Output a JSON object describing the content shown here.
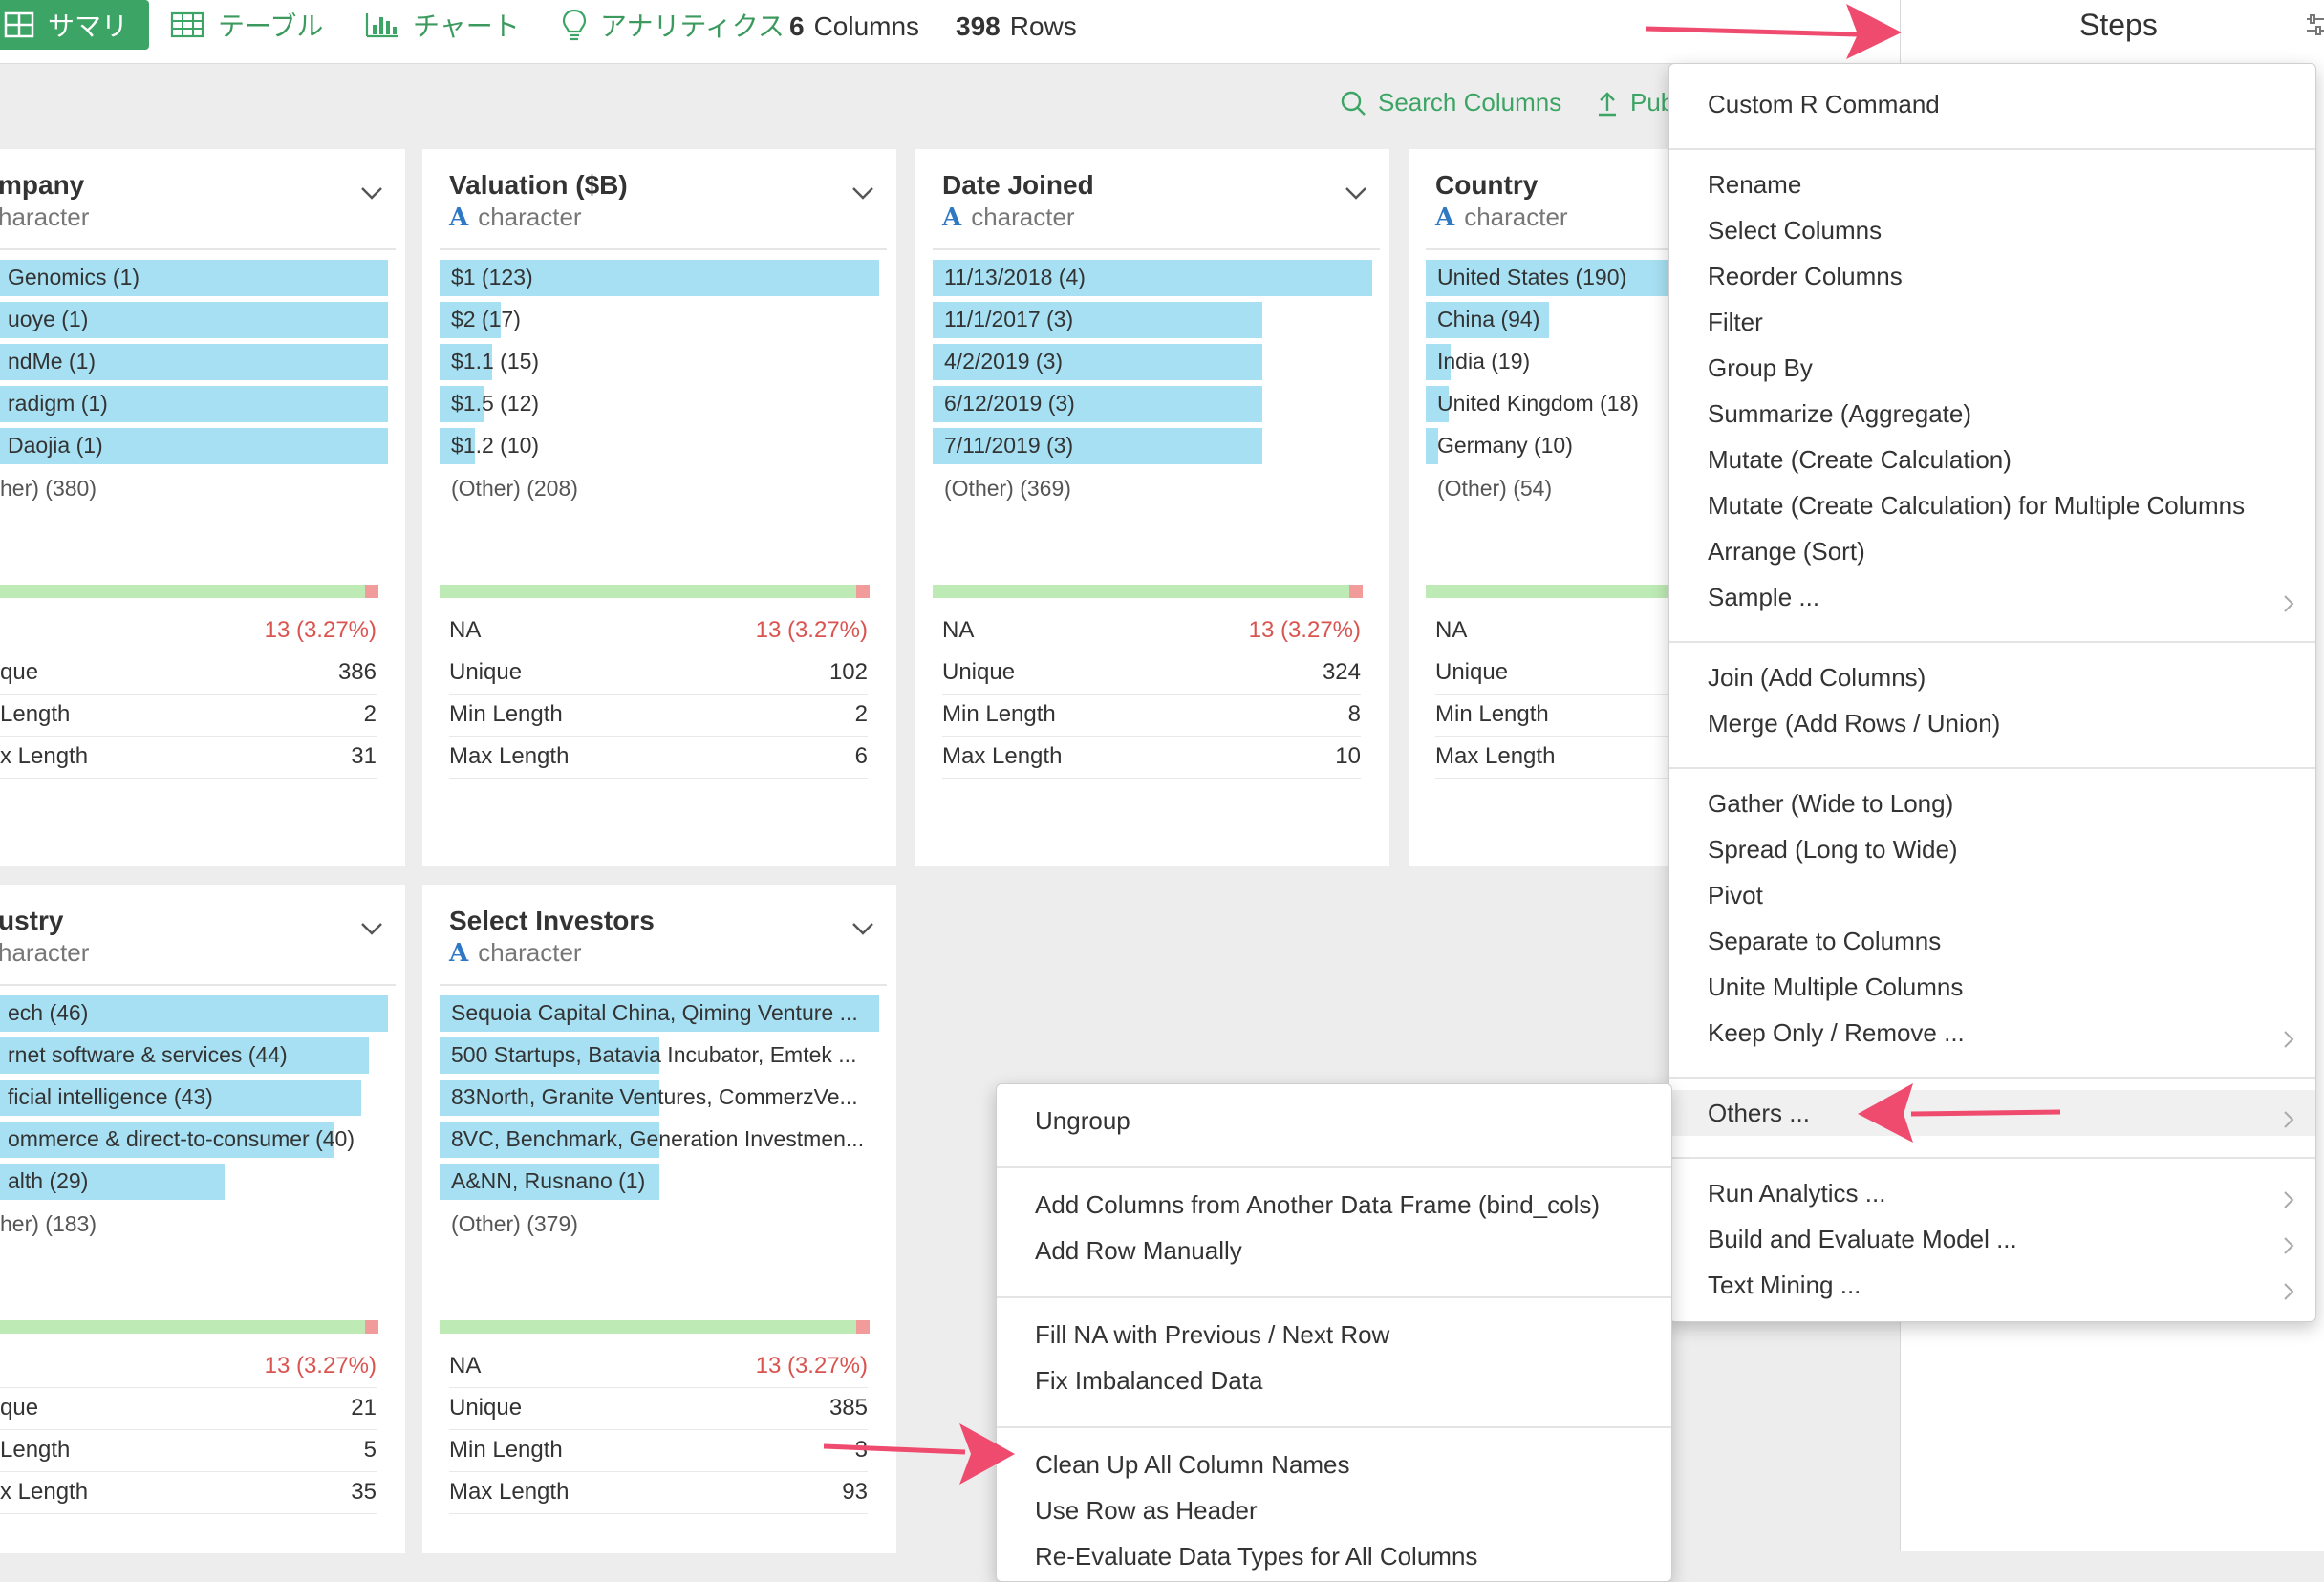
{
  "header": {
    "tabs": [
      {
        "label": "サマリ",
        "icon": "summary-grid-icon"
      },
      {
        "label": "テーブル",
        "icon": "table-icon"
      },
      {
        "label": "チャート",
        "icon": "bar-chart-icon"
      },
      {
        "label": "アナリティクス",
        "icon": "lightbulb-icon"
      }
    ],
    "columns_count": "6",
    "columns_label": "Columns",
    "rows_count": "398",
    "rows_label": "Rows",
    "steps_label": "Steps"
  },
  "toolbar": {
    "search_columns": "Search Columns",
    "publish": "Pub"
  },
  "colors": {
    "accent": "#3ca465",
    "bar": "#a6e0f2",
    "na_ok": "#bdeab5",
    "na_missing": "#f29b9b",
    "arrow": "#ef4b6e"
  },
  "cards": [
    {
      "title": "mpany",
      "type": "haracter",
      "bars": [
        {
          "label": "Genomics (1)",
          "pct": 100
        },
        {
          "label": "uoye (1)",
          "pct": 100
        },
        {
          "label": "ndMe (1)",
          "pct": 100
        },
        {
          "label": "radigm (1)",
          "pct": 100
        },
        {
          "label": "Daojia (1)",
          "pct": 100
        }
      ],
      "other": "her) (380)",
      "stats": [
        {
          "k": "",
          "v": "13 (3.27%)",
          "red": true
        },
        {
          "k": "que",
          "v": "386"
        },
        {
          "k": " Length",
          "v": "2"
        },
        {
          "k": "x Length",
          "v": "31"
        }
      ]
    },
    {
      "title": "Valuation ($B)",
      "type": "character",
      "typeIcon": "A",
      "bars": [
        {
          "label": "$1 (123)",
          "pct": 100
        },
        {
          "label": "$2 (17)",
          "pct": 14
        },
        {
          "label": "$1.1 (15)",
          "pct": 12
        },
        {
          "label": "$1.5 (12)",
          "pct": 10
        },
        {
          "label": "$1.2 (10)",
          "pct": 8
        }
      ],
      "other": "(Other) (208)",
      "stats": [
        {
          "k": "NA",
          "v": "13 (3.27%)",
          "red": true
        },
        {
          "k": "Unique",
          "v": "102"
        },
        {
          "k": "Min Length",
          "v": "2"
        },
        {
          "k": "Max Length",
          "v": "6"
        }
      ]
    },
    {
      "title": "Date Joined",
      "type": "character",
      "typeIcon": "A",
      "bars": [
        {
          "label": "11/13/2018 (4)",
          "pct": 100
        },
        {
          "label": "11/1/2017 (3)",
          "pct": 75
        },
        {
          "label": "4/2/2019 (3)",
          "pct": 75
        },
        {
          "label": "6/12/2019 (3)",
          "pct": 75
        },
        {
          "label": "7/11/2019 (3)",
          "pct": 75
        }
      ],
      "other": "(Other) (369)",
      "stats": [
        {
          "k": "NA",
          "v": "13 (3.27%)",
          "red": true
        },
        {
          "k": "Unique",
          "v": "324"
        },
        {
          "k": "Min Length",
          "v": "8"
        },
        {
          "k": "Max Length",
          "v": "10"
        }
      ]
    },
    {
      "title": "Country",
      "type": "character",
      "typeIcon": "A",
      "bars": [
        {
          "label": "United States (190)",
          "pct": 100
        },
        {
          "label": "China (94)",
          "pct": 49
        },
        {
          "label": "India (19)",
          "pct": 10
        },
        {
          "label": "United Kingdom (18)",
          "pct": 9
        },
        {
          "label": "Germany (10)",
          "pct": 5
        }
      ],
      "other": "(Other) (54)",
      "stats": [
        {
          "k": "NA",
          "v": "",
          "red": true
        },
        {
          "k": "Unique",
          "v": ""
        },
        {
          "k": "Min Length",
          "v": ""
        },
        {
          "k": "Max Length",
          "v": ""
        }
      ]
    },
    {
      "title": "ustry",
      "type": "haracter",
      "bars": [
        {
          "label": "ech (46)",
          "pct": 100
        },
        {
          "label": "rnet software & services (44)",
          "pct": 95
        },
        {
          "label": "ficial intelligence (43)",
          "pct": 93
        },
        {
          "label": "ommerce & direct-to-consumer (40)",
          "pct": 86
        },
        {
          "label": "alth (29)",
          "pct": 58
        }
      ],
      "other": "her) (183)",
      "stats": [
        {
          "k": "",
          "v": "13 (3.27%)",
          "red": true
        },
        {
          "k": "que",
          "v": "21"
        },
        {
          "k": " Length",
          "v": "5"
        },
        {
          "k": "x Length",
          "v": "35"
        }
      ]
    },
    {
      "title": "Select Investors",
      "type": "character",
      "typeIcon": "A",
      "bars": [
        {
          "label": "Sequoia Capital China, Qiming Venture ...",
          "pct": 100
        },
        {
          "label": "500 Startups, Batavia Incubator, Emtek ...",
          "pct": 50
        },
        {
          "label": "83North, Granite Ventures, CommerzVe...",
          "pct": 50
        },
        {
          "label": "8VC, Benchmark, Generation Investmen...",
          "pct": 50
        },
        {
          "label": "A&NN, Rusnano (1)",
          "pct": 50
        }
      ],
      "other": "(Other) (379)",
      "stats": [
        {
          "k": "NA",
          "v": "13 (3.27%)",
          "red": true
        },
        {
          "k": "Unique",
          "v": "385"
        },
        {
          "k": "Min Length",
          "v": "3"
        },
        {
          "k": "Max Length",
          "v": "93"
        }
      ]
    }
  ],
  "add_menu": {
    "groups": [
      [
        "Custom R Command"
      ],
      [
        "Rename",
        "Select Columns",
        "Reorder Columns",
        "Filter",
        "Group By",
        "Summarize (Aggregate)",
        "Mutate (Create Calculation)",
        "Mutate (Create Calculation) for Multiple Columns",
        "Arrange (Sort)",
        "Sample ..."
      ],
      [
        "Join (Add Columns)",
        "Merge (Add Rows / Union)"
      ],
      [
        "Gather (Wide to Long)",
        "Spread (Long to Wide)",
        "Pivot",
        "Separate to Columns",
        "Unite Multiple Columns",
        "Keep Only / Remove ..."
      ],
      [
        "Others ..."
      ],
      [
        "Run Analytics ...",
        "Build and Evaluate Model ...",
        "Text Mining ..."
      ]
    ]
  },
  "others_menu": {
    "groups": [
      [
        "Ungroup"
      ],
      [
        "Add Columns from Another Data Frame (bind_cols)",
        "Add Row Manually"
      ],
      [
        "Fill NA with Previous / Next Row",
        "Fix Imbalanced Data"
      ],
      [
        "Clean Up All Column Names",
        "Use Row as Header",
        "Re-Evaluate Data Types for All Columns"
      ]
    ]
  }
}
